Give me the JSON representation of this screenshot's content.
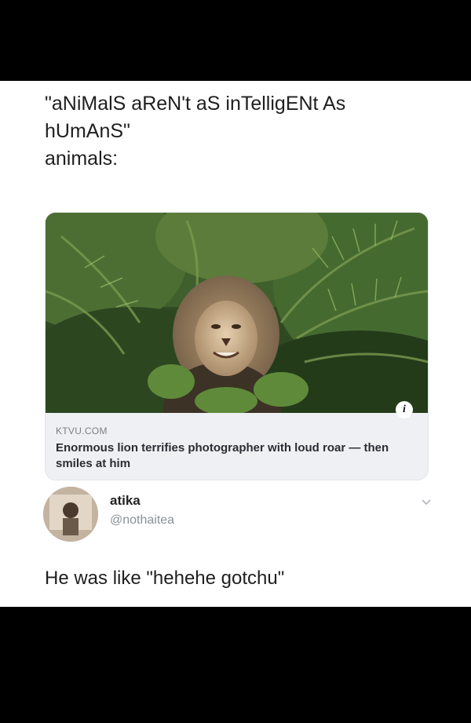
{
  "caption": {
    "line1": "\"aNiMalS aReN't aS inTelligENt As",
    "line2": "hUmAnS\"",
    "line3": "animals:"
  },
  "link_card": {
    "domain": "KTVU.COM",
    "headline": "Enormous lion terrifies photographer with loud roar — then smiles at him",
    "info_icon": "info-icon"
  },
  "reply": {
    "name": "atika",
    "handle": "@nothaitea",
    "text": "He was like \"hehehe gotchu\""
  },
  "colors": {
    "background": "#000000",
    "panel": "#ffffff",
    "card": "#eef0f3",
    "muted": "#8b9097"
  }
}
